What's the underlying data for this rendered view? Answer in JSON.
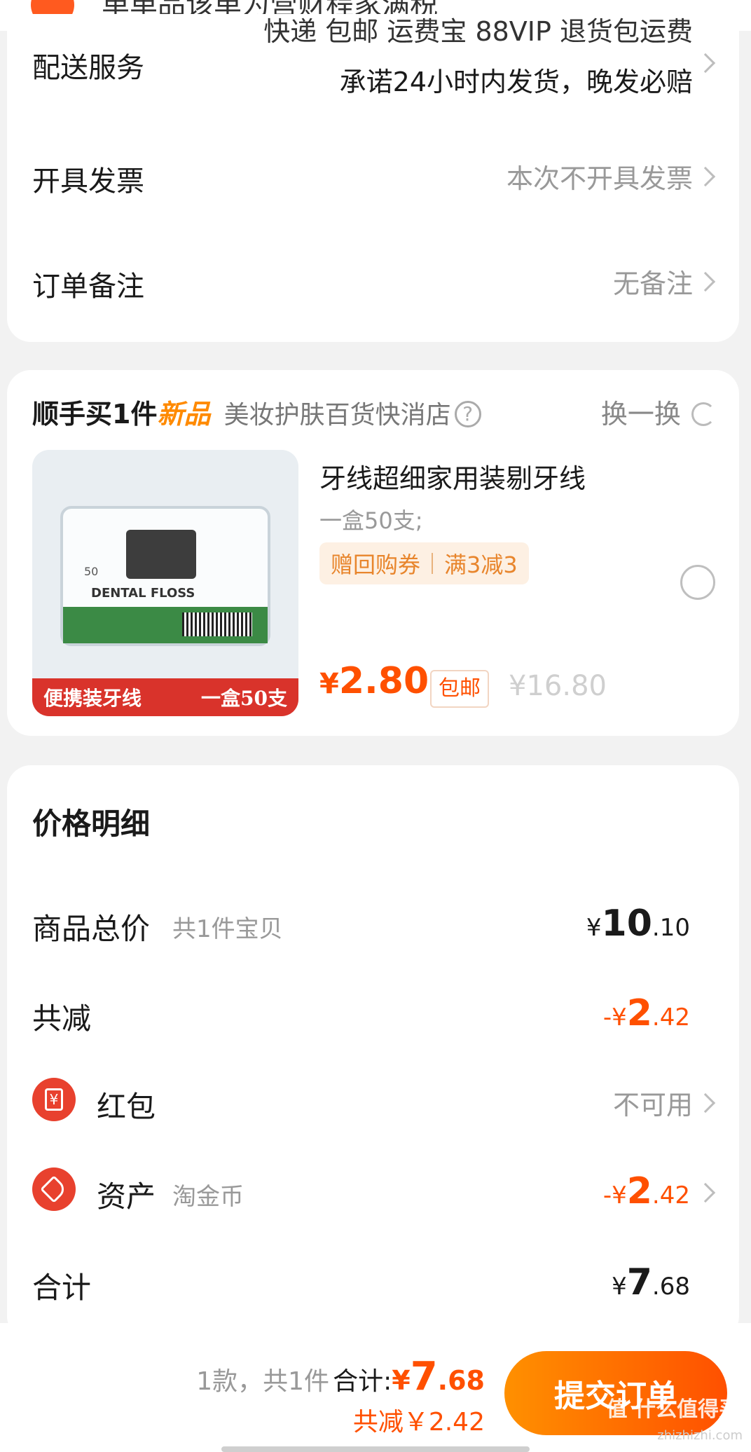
{
  "top": {
    "faded_text": "单单品该单为营财程家满税"
  },
  "delivery": {
    "label": "配送服务",
    "line1": "快递 包邮 运费宝 88VIP 退货包运费",
    "line2": "承诺24小时内发货，晚发必赔"
  },
  "invoice": {
    "label": "开具发票",
    "value": "本次不开具发票"
  },
  "remark": {
    "label": "订单备注",
    "value": "无备注"
  },
  "addon": {
    "title": "顺手买1件",
    "new_tag": "新品",
    "store": "美妆护肤百货快消店",
    "help_icon": "question-circle-icon",
    "refresh_label": "换一换",
    "refresh_icon": "refresh-icon",
    "product": {
      "name": "牙线超细家用装剔牙线",
      "spec": "一盒50支;",
      "coupon_a": "赠回购券",
      "coupon_b": "满3减3",
      "img_banner_left": "便携装牙线",
      "img_banner_right": "一盒50支",
      "img_box_text": "DENTAL FLOSS",
      "img_count": "50",
      "price_symbol": "¥",
      "price": "2.80",
      "shipping": "包邮",
      "original_price": "¥16.80"
    }
  },
  "price_detail": {
    "title": "价格明细",
    "goods_total": {
      "label": "商品总价",
      "sub": "共1件宝贝",
      "sym": "¥",
      "int": "10",
      "dec": ".10"
    },
    "discount": {
      "label": "共减",
      "sym": "-¥",
      "int": "2",
      "dec": ".42"
    },
    "redpacket": {
      "label": "红包",
      "value": "不可用",
      "icon": "red-packet-icon",
      "icon_text": "¥"
    },
    "assets": {
      "label": "资产",
      "sub": "淘金币",
      "sym": "-¥",
      "int": "2",
      "dec": ".42",
      "icon": "tag-icon"
    },
    "total": {
      "label": "合计",
      "sym": "¥",
      "int": "7",
      "dec": ".68"
    }
  },
  "footer": {
    "count": "1款，共1件",
    "total_label": "合计:",
    "total_sym": "¥",
    "total_int": "7",
    "total_dec": ".68",
    "saved": "共减￥2.42",
    "submit": "提交订单",
    "watermark": "值 什么值得买",
    "watermark_url": "zhizhizhi.com"
  },
  "colors": {
    "accent": "#ff5000",
    "button_start": "#ff9000",
    "button_end": "#ff5000",
    "coupon_bg": "#fdf0e3",
    "banner_red": "#d9332b"
  }
}
